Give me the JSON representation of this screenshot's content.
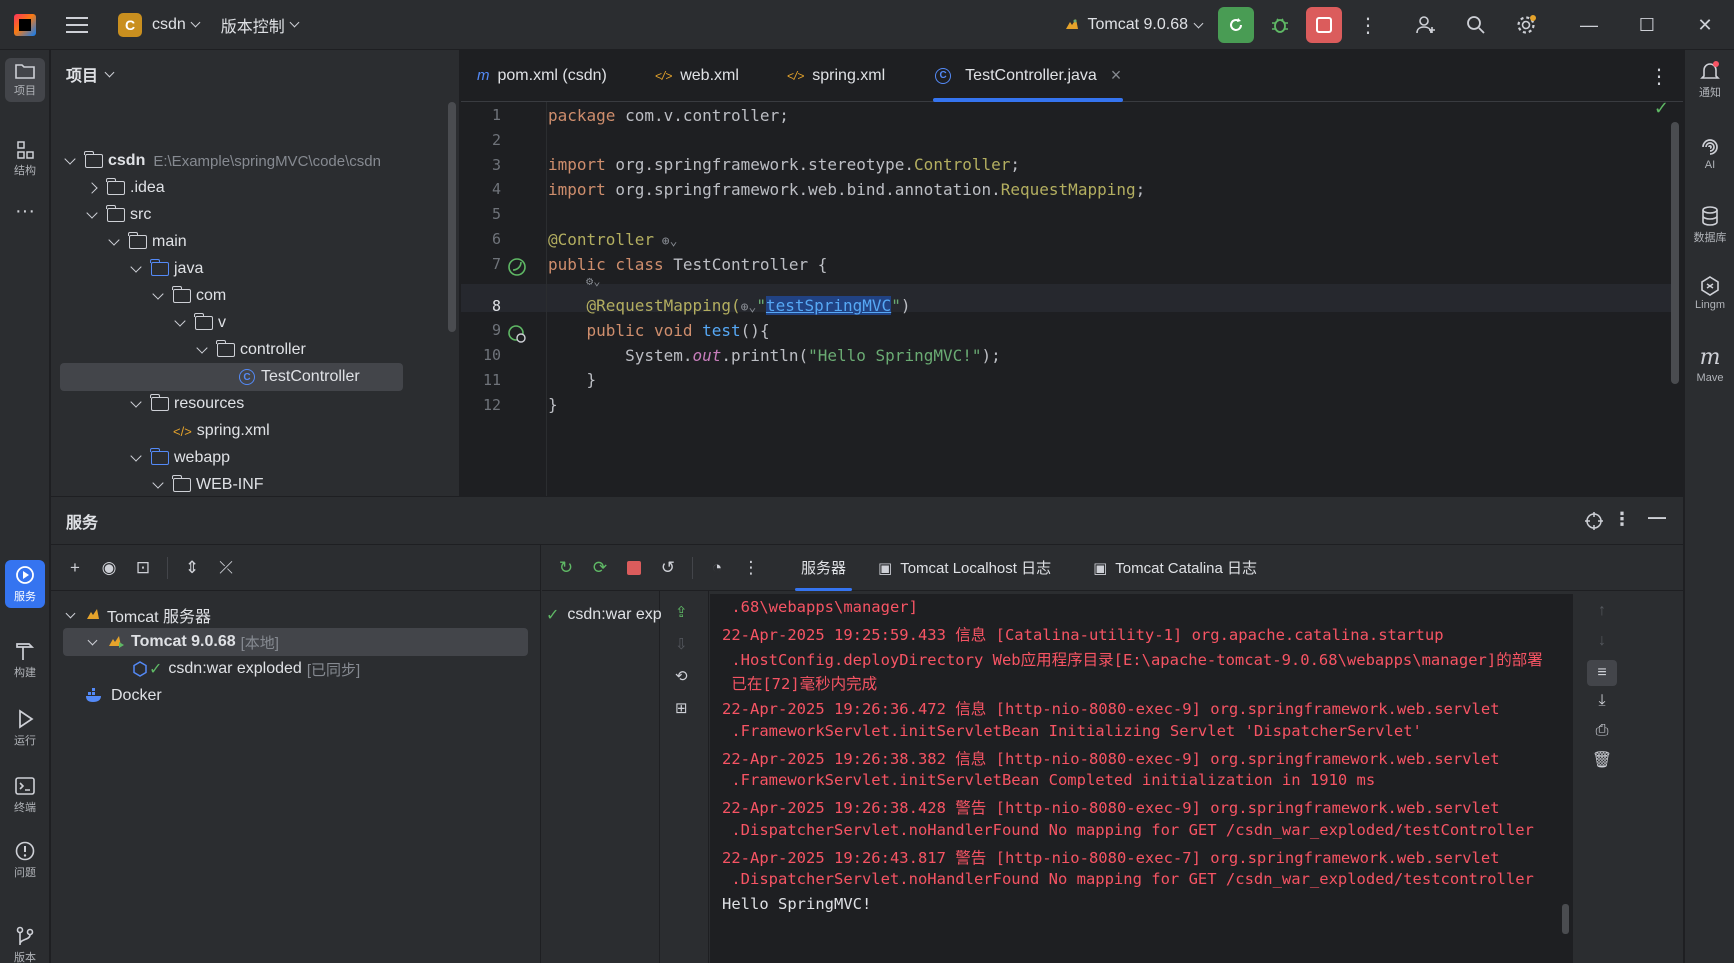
{
  "titlebar": {
    "project_badge": "C",
    "project_name": "csdn",
    "vcs_label": "版本控制",
    "run_config": "Tomcat 9.0.68",
    "win_minimize": "—",
    "win_maximize": "☐",
    "win_close": "✕"
  },
  "left_strip": {
    "project": "项目",
    "structure": "结构",
    "services": "服务",
    "build": "构建",
    "run": "运行",
    "terminal": "终端",
    "problems": "问题",
    "git": "版本"
  },
  "right_strip": {
    "notifications": "通知",
    "ai": "AI",
    "database": "数据库",
    "lingma": "Lingm",
    "maven": "Mave"
  },
  "project_panel": {
    "title": "项目",
    "tree": [
      {
        "label": "csdn",
        "path": "E:\\Example\\springMVC\\code\\csdn"
      },
      {
        "label": ".idea"
      },
      {
        "label": "src"
      },
      {
        "label": "main"
      },
      {
        "label": "java"
      },
      {
        "label": "com"
      },
      {
        "label": "v"
      },
      {
        "label": "controller"
      },
      {
        "label": "TestController"
      },
      {
        "label": "resources"
      },
      {
        "label": "spring.xml"
      },
      {
        "label": "webapp"
      },
      {
        "label": "WEB-INF"
      }
    ]
  },
  "editor": {
    "tabs": [
      {
        "icon": "m",
        "label": "pom.xml (csdn)"
      },
      {
        "icon": "</>",
        "label": "web.xml"
      },
      {
        "icon": "</>",
        "label": "spring.xml"
      },
      {
        "icon": "C",
        "label": "TestController.java",
        "close": "×"
      }
    ],
    "line_numbers": [
      "1",
      "2",
      "3",
      "4",
      "5",
      "6",
      "7",
      "8",
      "9",
      "10",
      "11",
      "12"
    ],
    "code": {
      "l1_kw": "package",
      "l1_rest": " com.v.controller;",
      "l3_kw": "import",
      "l3_pkg": " org.springframework.stereotype.",
      "l3_cls": "Controller",
      "l3_end": ";",
      "l4_kw": "import",
      "l4_pkg": " org.springframework.web.bind.annotation.",
      "l4_cls": "RequestMapping",
      "l4_end": ";",
      "l6_ann": "@Controller",
      "l7_kw": "public class",
      "l7_rest": " TestController {",
      "l8_ann": "@RequestMapping(",
      "l8_q1": "\"",
      "l8_str": "testSpringMVC",
      "l8_q2": "\"",
      "l8_end": ")",
      "l9_kw": "public void",
      "l9_fn": " test",
      "l9_end": "(){",
      "l10_a": "System.",
      "l10_out": "out",
      "l10_b": ".println(",
      "l10_str": "\"Hello SpringMVC!\"",
      "l10_c": ");",
      "l11": "}",
      "l12": "}"
    }
  },
  "services": {
    "title": "服务",
    "tree": [
      {
        "label": "Tomcat 服务器"
      },
      {
        "label": "Tomcat 9.0.68",
        "tag": "[本地]"
      },
      {
        "label": "csdn:war exploded",
        "tag": "[已同步]"
      },
      {
        "label": "Docker"
      }
    ],
    "deployment_item": "csdn:war exp",
    "console_tabs": [
      "服务器",
      "Tomcat Localhost 日志",
      "Tomcat Catalina 日志"
    ],
    "log_lines": [
      " .68\\webapps\\manager]",
      "22-Apr-2025 19:25:59.433 信息 [Catalina-utility-1] org.apache.catalina.startup",
      " .HostConfig.deployDirectory Web应用程序目录[E:\\apache-tomcat-9.0.68\\webapps\\manager]的部署",
      " 已在[72]毫秒内完成",
      "22-Apr-2025 19:26:36.472 信息 [http-nio-8080-exec-9] org.springframework.web.servlet",
      " .FrameworkServlet.initServletBean Initializing Servlet 'DispatcherServlet'",
      "22-Apr-2025 19:26:38.382 信息 [http-nio-8080-exec-9] org.springframework.web.servlet",
      " .FrameworkServlet.initServletBean Completed initialization in 1910 ms",
      "22-Apr-2025 19:26:38.428 警告 [http-nio-8080-exec-9] org.springframework.web.servlet",
      " .DispatcherServlet.noHandlerFound No mapping for GET /csdn_war_exploded/testController",
      "22-Apr-2025 19:26:43.817 警告 [http-nio-8080-exec-7] org.springframework.web.servlet",
      " .DispatcherServlet.noHandlerFound No mapping for GET /csdn_war_exploded/testcontroller",
      "Hello SpringMVC!"
    ]
  },
  "colors": {
    "accent": "#3574f0",
    "run_green": "#499c54",
    "stop_red": "#db5c5c",
    "log_red": "#f75464"
  }
}
